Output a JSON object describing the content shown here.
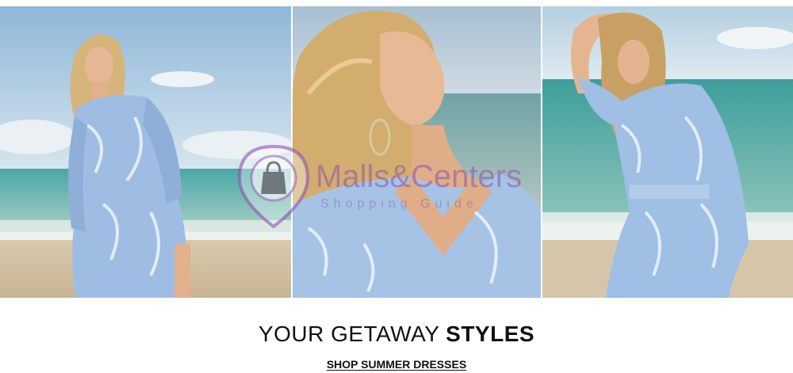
{
  "hero": {
    "images": [
      {
        "subject": "woman-in-blue-floral-dress-on-beach"
      },
      {
        "subject": "woman-portrait-blonde-hair-hoop-earring"
      },
      {
        "subject": "woman-adjusting-hair-beach-blue-dress"
      }
    ]
  },
  "watermark": {
    "title": "Malls&Centers",
    "subtitle": "Shopping Guide",
    "color": "#8c50af"
  },
  "promo": {
    "headline_light": "YOUR GETAWAY ",
    "headline_bold": "STYLES",
    "cta_label": "SHOP SUMMER DRESSES"
  }
}
